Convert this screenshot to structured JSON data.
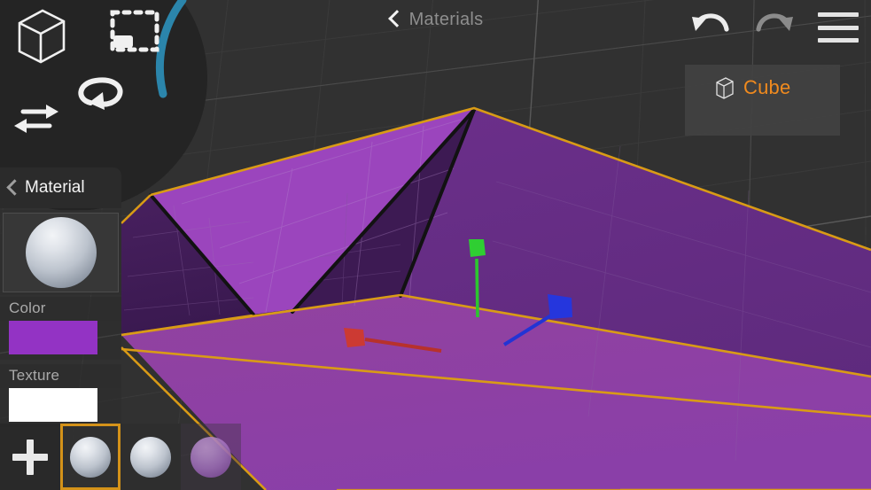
{
  "app": {
    "title": "Materials",
    "back_icon": "chevron-left-icon"
  },
  "toolbar_left": {
    "tools": [
      {
        "id": "cube",
        "icon": "cube-icon",
        "label": "Cube"
      },
      {
        "id": "select",
        "icon": "marquee-select-icon",
        "label": "Select"
      },
      {
        "id": "rotate",
        "icon": "rotate-icon",
        "label": "Rotate"
      },
      {
        "id": "move",
        "icon": "move-horizontal-arrows-icon",
        "label": "Move"
      }
    ],
    "arc_color": "#2b85ab",
    "panel_color": "#242424"
  },
  "toolbar_right": {
    "undo": {
      "icon": "undo-arrow-icon",
      "label": "Undo",
      "enabled": true,
      "color": "#ededed"
    },
    "redo": {
      "icon": "redo-arrow-icon",
      "label": "Redo",
      "enabled": false,
      "color": "#8b8b8b"
    },
    "menu": {
      "icon": "hamburger-menu-icon",
      "label": "Menu"
    }
  },
  "object_panel": {
    "icon": "cube-icon",
    "name": "Cube",
    "name_color": "#f08a1e",
    "background": "#424242"
  },
  "material_panel": {
    "back_icon": "chevron-left-icon",
    "title": "Material",
    "preview": {
      "icon": "material-sphere-preview",
      "label": "Material preview sphere"
    },
    "properties": [
      {
        "key": "color",
        "label": "Color",
        "value": "#9333c4"
      },
      {
        "key": "texture",
        "label": "Texture",
        "value": "#ffffff"
      }
    ]
  },
  "material_strip": {
    "add_label": "+",
    "add_icon": "plus-icon",
    "selected_index": 0,
    "selection_color": "#d49219",
    "slots": [
      {
        "index": 0,
        "name": "Material 1",
        "color": "#c3c9d2",
        "selected": true
      },
      {
        "index": 1,
        "name": "Material 2",
        "color": "#c3c9d2",
        "selected": false
      },
      {
        "index": 2,
        "name": "Material 3",
        "color": "#a470c0",
        "selected": false
      }
    ]
  },
  "viewport": {
    "background": "#313131",
    "grid_color": "#6a6a6a",
    "mesh": {
      "name": "Cube",
      "face_light": "#8f3fb0",
      "face_mid": "#7c38a0",
      "face_dark": "#4a2063",
      "face_darkest": "#3a1950",
      "outline_color": "#d99b16",
      "edge_color": "#151515"
    },
    "gizmo": {
      "axes": [
        {
          "axis": "x",
          "color": "#c9332e",
          "handle": "x-axis-handle",
          "head": [
            399,
            380
          ],
          "tail": [
            498,
            396
          ]
        },
        {
          "axis": "y",
          "color": "#27c52a",
          "handle": "y-axis-handle",
          "head": [
            537,
            279
          ],
          "tail": [
            539,
            357
          ]
        },
        {
          "axis": "z",
          "color": "#2536d8",
          "handle": "z-axis-handle",
          "head": [
            631,
            346
          ],
          "tail": [
            569,
            388
          ]
        }
      ]
    }
  }
}
